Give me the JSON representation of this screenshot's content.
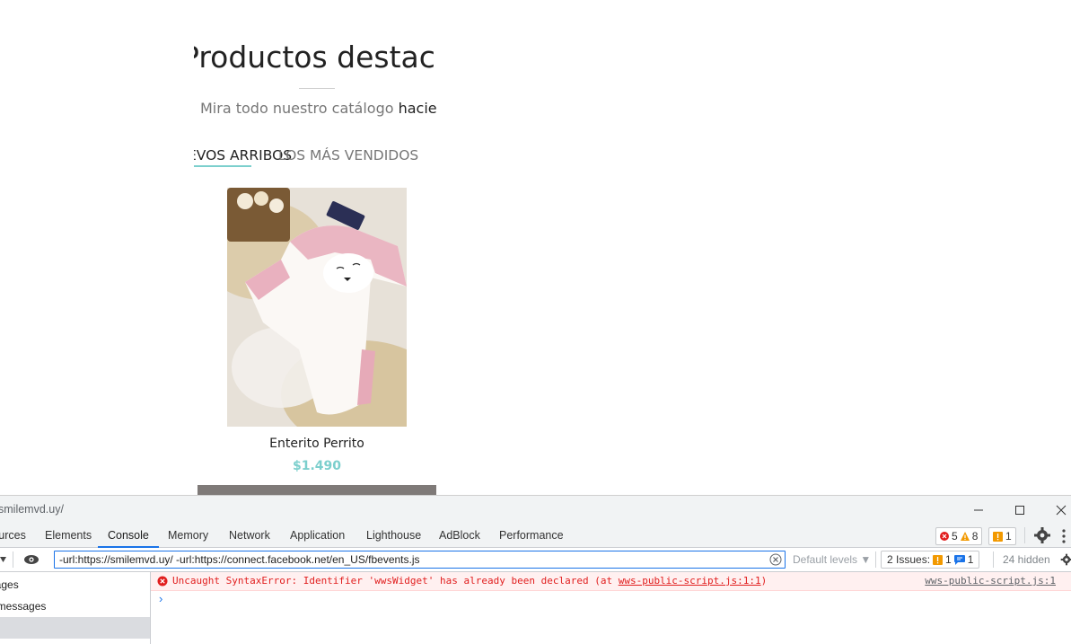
{
  "site": {
    "section_title": "Productos destacados",
    "subtitle_prefix": "Mira todo nuestro catálogo",
    "subtitle_link": "haciendo",
    "tab_new": "NUEVOS ARRIBOS",
    "tab_best": "LOS MÁS VENDIDOS",
    "product": {
      "name": "Enterito Perrito",
      "price": "$1.490"
    }
  },
  "devtools": {
    "window_url": "smilemvd.uy/",
    "tabs": [
      "Sources",
      "Elements",
      "Console",
      "Memory",
      "Network",
      "Application",
      "Lighthouse",
      "AdBlock",
      "Performance"
    ],
    "active_tab": "Console",
    "counts": {
      "errors": "5",
      "warnings": "8",
      "issues": "1"
    },
    "filter_value": "-url:https://smilemvd.uy/ -url:https://connect.facebook.net/en_US/fbevents.js",
    "levels": "Default levels ▼",
    "issues_button": {
      "label": "2 Issues:",
      "warn_count": "1",
      "info_count": "1"
    },
    "hidden": "24 hidden",
    "sidebar": [
      "messages",
      "user messages",
      ""
    ],
    "error": {
      "text_before": "Uncaught SyntaxError: Identifier 'wwsWidget' has already been declared (at ",
      "link": "wws-public-script.js:1:1",
      "text_after": ")",
      "source": "wws-public-script.js:1"
    },
    "prompt": "›"
  },
  "colors": {
    "accent": "#7ccfcd",
    "error": "#e11e1e",
    "devtools_blue": "#1a73e8"
  }
}
